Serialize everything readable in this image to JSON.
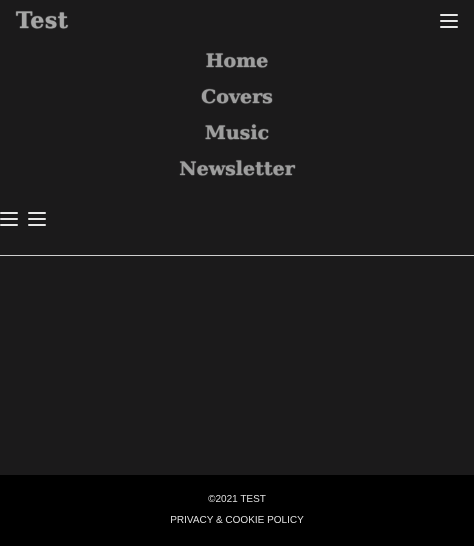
{
  "header": {
    "site_title": "Test",
    "menu_icon": "hamburger-menu-icon"
  },
  "nav": {
    "items": [
      {
        "label": "Home"
      },
      {
        "label": "Covers"
      },
      {
        "label": "Music"
      },
      {
        "label": "Newsletter"
      }
    ],
    "secondary_icons": [
      "hamburger-menu-icon",
      "hamburger-menu-icon"
    ]
  },
  "footer": {
    "copyright": "©2021 TEST",
    "policy_link": "PRIVACY & COOKIE POLICY"
  },
  "colors": {
    "background": "#1b1a1b",
    "footer_background": "#000000",
    "nav_text": "#9e9e9e",
    "footer_text": "#e0e0e0"
  }
}
